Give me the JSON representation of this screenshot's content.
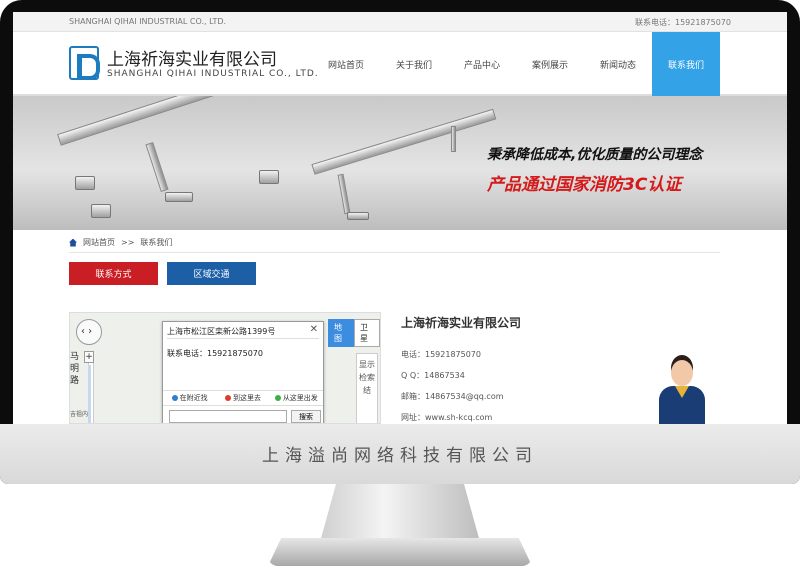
{
  "site": {
    "topbar_left": "SHANGHAI QIHAI INDUSTRIAL CO., LTD.",
    "topbar_right": "联系电话：15921875070",
    "logo_cn": "上海祈海实业有限公司",
    "logo_en": "SHANGHAI QIHAI INDUSTRIAL CO., LTD.",
    "nav": [
      "网站首页",
      "关于我们",
      "产品中心",
      "案例展示",
      "新闻动态",
      "联系我们"
    ],
    "active_nav": "联系我们",
    "banner_line1": "秉承降低成本,优化质量的公司理念",
    "banner_line2": "产品通过国家消防3C认证",
    "breadcrumb": {
      "home": "网站首页",
      "sep": ">>",
      "current": "联系我们"
    },
    "tabs": [
      "联系方式",
      "区域交通"
    ],
    "map": {
      "road_label": "马明路",
      "road_label2": "吉祖内",
      "map_type": [
        "地图",
        "卫星"
      ],
      "side_hint": "显示检索结",
      "popup_title": "上海市松江区栾新公路1399号",
      "popup_phone": "联系电话：15921875070",
      "popup_tabs": [
        "在附近找",
        "到这里去",
        "从这里出发"
      ],
      "popup_button": "搜索"
    },
    "contact": {
      "company": "上海祈海实业有限公司",
      "rows": [
        "电话：15921875070",
        "Q Q：14867534",
        "邮箱：14867534@qq.com",
        "网址：www.sh-kcq.com"
      ]
    }
  },
  "monitor_caption": "上海溢尚网络科技有限公司",
  "colors": {
    "accent_blue": "#33a2e7",
    "red": "#c81e24",
    "navy": "#1c5fa7"
  }
}
